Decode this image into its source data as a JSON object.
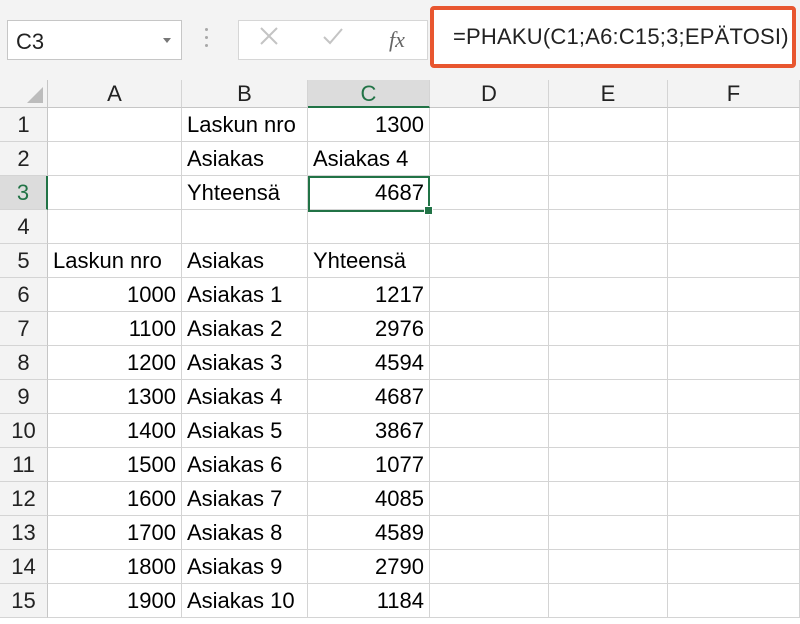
{
  "name_box": {
    "value": "C3"
  },
  "formula": {
    "text": "=PHAKU(C1;A6:C15;3;EPÄTOSI)"
  },
  "icons": {
    "cancel": "close-icon",
    "enter": "check-icon",
    "function": "fx-icon"
  },
  "accent_colors": {
    "selection": "#217346",
    "highlight": "#e8562f"
  },
  "columns": [
    "A",
    "B",
    "C",
    "D",
    "E",
    "F"
  ],
  "active_column": "C",
  "rows": [
    {
      "num": "1",
      "A": "",
      "B": "Laskun nro",
      "C": "1300"
    },
    {
      "num": "2",
      "A": "",
      "B": "Asiakas",
      "C": "Asiakas 4"
    },
    {
      "num": "3",
      "A": "",
      "B": "Yhteensä",
      "C": "4687"
    },
    {
      "num": "4",
      "A": "",
      "B": "",
      "C": ""
    },
    {
      "num": "5",
      "A": "Laskun nro",
      "B": "Asiakas",
      "C": "Yhteensä"
    },
    {
      "num": "6",
      "A": "1000",
      "B": "Asiakas 1",
      "C": "1217"
    },
    {
      "num": "7",
      "A": "1100",
      "B": "Asiakas 2",
      "C": "2976"
    },
    {
      "num": "8",
      "A": "1200",
      "B": "Asiakas 3",
      "C": "4594"
    },
    {
      "num": "9",
      "A": "1300",
      "B": "Asiakas 4",
      "C": "4687"
    },
    {
      "num": "10",
      "A": "1400",
      "B": "Asiakas 5",
      "C": "3867"
    },
    {
      "num": "11",
      "A": "1500",
      "B": "Asiakas 6",
      "C": "1077"
    },
    {
      "num": "12",
      "A": "1600",
      "B": "Asiakas 7",
      "C": "4085"
    },
    {
      "num": "13",
      "A": "1700",
      "B": "Asiakas 8",
      "C": "4589"
    },
    {
      "num": "14",
      "A": "1800",
      "B": "Asiakas 9",
      "C": "2790"
    },
    {
      "num": "15",
      "A": "1900",
      "B": "Asiakas 10",
      "C": "1184"
    }
  ],
  "active_row": "3"
}
